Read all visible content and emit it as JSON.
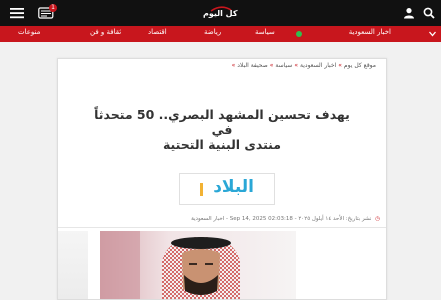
{
  "header": {
    "notification_count": "1",
    "logo_text": "كل اليوم"
  },
  "nav": {
    "items": [
      {
        "label": "اخبار السعودية"
      },
      {
        "label": "سياسة"
      },
      {
        "label": "رياضة"
      },
      {
        "label": "اقتصاد"
      },
      {
        "label": "ثقافة و فن"
      },
      {
        "label": "منوعات"
      }
    ]
  },
  "breadcrumb": {
    "items": [
      "موقع كل يوم",
      "اخبار السعودية",
      "سياسة",
      "صحيفة البلاد"
    ]
  },
  "article": {
    "title_line1": "يهدف تحسين المشهد البصري.. 50 متحدثاً في",
    "title_line2": "منتدى البنية التحتية",
    "publisher_logo_text": "البلاد",
    "meta": {
      "prefix": "نشر بتاريخ:",
      "date_ar": "الأحد ١٤ أيلول ٢٠٢٥ -",
      "date_en": "Sep 14, 2025 02:03:18",
      "category": "اخبار السعودية"
    }
  },
  "colors": {
    "topbar": "#111111",
    "accent_red": "#c8161d",
    "logo_blue": "#2aa7d6",
    "logo_yellow": "#f2b233"
  },
  "icons": [
    "menu-icon",
    "notification-icon",
    "user-icon",
    "search-icon",
    "chevron-down-icon",
    "clock-icon"
  ]
}
